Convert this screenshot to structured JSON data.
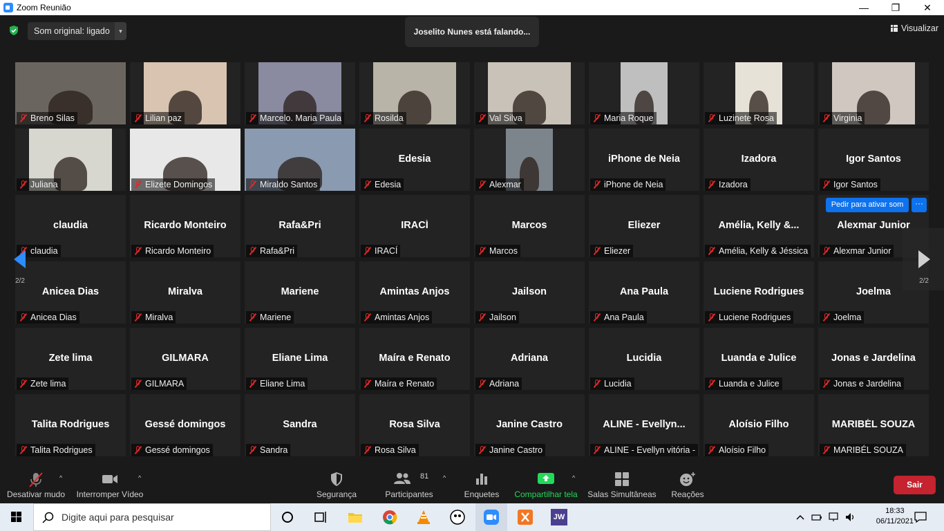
{
  "window": {
    "title": "Zoom Reunião",
    "minimize": "—",
    "maximize": "❐",
    "close": "✕"
  },
  "topbar": {
    "audio_label": "Som original: ligado",
    "audio_caret": "▾",
    "speaking": "Joselito Nunes está falando...",
    "view_label": "Visualizar"
  },
  "gallery": {
    "page_left": "2/2",
    "page_right": "2/2",
    "ask_unmute": "Pedir para ativar som",
    "more": "···",
    "tiles": [
      {
        "label": "Breno Silas",
        "video": true,
        "wide": true,
        "bg": "#6b6560"
      },
      {
        "label": "Lilian paz",
        "video": true,
        "bg": "#d8c4b0"
      },
      {
        "label": "Marcelo. Maria Paula",
        "video": true,
        "bg": "#8a8aa0"
      },
      {
        "label": "Rosilda",
        "video": true,
        "bg": "#b8b4a8"
      },
      {
        "label": "Val Silva",
        "video": true,
        "bg": "#c9c2b8"
      },
      {
        "label": "Maria Roque",
        "video": true,
        "narrow": true,
        "bg": "#bfbfbf"
      },
      {
        "label": "Luzinete Rosa",
        "video": true,
        "narrow": true,
        "bg": "#e6e2d8"
      },
      {
        "label": "Virginia",
        "video": true,
        "bg": "#cfc7c0"
      },
      {
        "label": "Juliana",
        "video": true,
        "bg": "#d7d7cf"
      },
      {
        "label": "Elizete Domingos",
        "video": true,
        "wide": true,
        "bg": "#e8e8e8"
      },
      {
        "label": "Miraldo Santos",
        "video": true,
        "wide": true,
        "bg": "#8a9ab0"
      },
      {
        "name": "Edesia",
        "label": "Edesia"
      },
      {
        "label": "Alexmar",
        "video": true,
        "narrow": true,
        "bg": "#7d858c"
      },
      {
        "name": "iPhone de Neia",
        "label": "iPhone de Neia"
      },
      {
        "name": "Izadora",
        "label": "Izadora"
      },
      {
        "name": "Igor Santos",
        "label": "Igor Santos"
      },
      {
        "name": "claudia",
        "label": "claudia"
      },
      {
        "name": "Ricardo Monteiro",
        "label": "Ricardo Monteiro"
      },
      {
        "name": "Rafa&Pri",
        "label": "Rafa&Pri"
      },
      {
        "name": "IRACÍ",
        "label": "IRACÍ"
      },
      {
        "name": "Marcos",
        "label": "Marcos"
      },
      {
        "name": "Eliezer",
        "label": "Eliezer"
      },
      {
        "name": "Amélia, Kelly &...",
        "label": "Amélia, Kelly & Jéssica"
      },
      {
        "name": "Alexmar Junior",
        "label": "Alexmar Junior"
      },
      {
        "name": "Anicea Dias",
        "label": "Anicea Dias"
      },
      {
        "name": "Miralva",
        "label": "Miralva"
      },
      {
        "name": "Mariene",
        "label": "Mariene"
      },
      {
        "name": "Amintas Anjos",
        "label": "Amintas Anjos"
      },
      {
        "name": "Jailson",
        "label": "Jailson"
      },
      {
        "name": "Ana Paula",
        "label": "Ana Paula"
      },
      {
        "name": "Luciene Rodrigues",
        "label": "Luciene Rodrigues"
      },
      {
        "name": "Joelma",
        "label": "Joelma"
      },
      {
        "name": "Zete lima",
        "label": "Zete lima"
      },
      {
        "name": "GILMARA",
        "label": "GILMARA"
      },
      {
        "name": "Eliane Lima",
        "label": "Eliane Lima"
      },
      {
        "name": "Maíra e Renato",
        "label": "Maíra e Renato"
      },
      {
        "name": "Adriana",
        "label": "Adriana"
      },
      {
        "name": "Lucidia",
        "label": "Lucidia"
      },
      {
        "name": "Luanda e Julice",
        "label": "Luanda e Julice"
      },
      {
        "name": "Jonas e Jardelina",
        "label": "Jonas e Jardelina"
      },
      {
        "name": "Talita Rodrigues",
        "label": "Talita Rodrigues"
      },
      {
        "name": "Gessé domingos",
        "label": "Gessé domingos"
      },
      {
        "name": "Sandra",
        "label": "Sandra"
      },
      {
        "name": "Rosa Silva",
        "label": "Rosa Silva"
      },
      {
        "name": "Janine Castro",
        "label": "Janine Castro"
      },
      {
        "name": "ALINE  - Evellyn...",
        "label": "ALINE - Evellyn vitória -"
      },
      {
        "name": "Aloísio Filho",
        "label": "Aloísio Filho"
      },
      {
        "name": "MARIBÉL SOUZA",
        "label": "MARIBÉL SOUZA"
      }
    ]
  },
  "toolbar": {
    "mute": "Desativar mudo",
    "video": "Interromper Vídeo",
    "security": "Segurança",
    "participants": "Participantes",
    "participants_count": "81",
    "polls": "Enquetes",
    "share": "Compartilhar tela",
    "breakout": "Salas Simultâneas",
    "reactions": "Reações",
    "leave": "Sair",
    "caret": "^"
  },
  "taskbar": {
    "search_placeholder": "Digite aqui para pesquisar",
    "jw_label": "JW",
    "time": "18:33",
    "date": "06/11/2021"
  },
  "colors": {
    "accent": "#2d8cff",
    "share_green": "#23d959",
    "leave_red": "#c4232f",
    "mute_red": "#e02828"
  }
}
